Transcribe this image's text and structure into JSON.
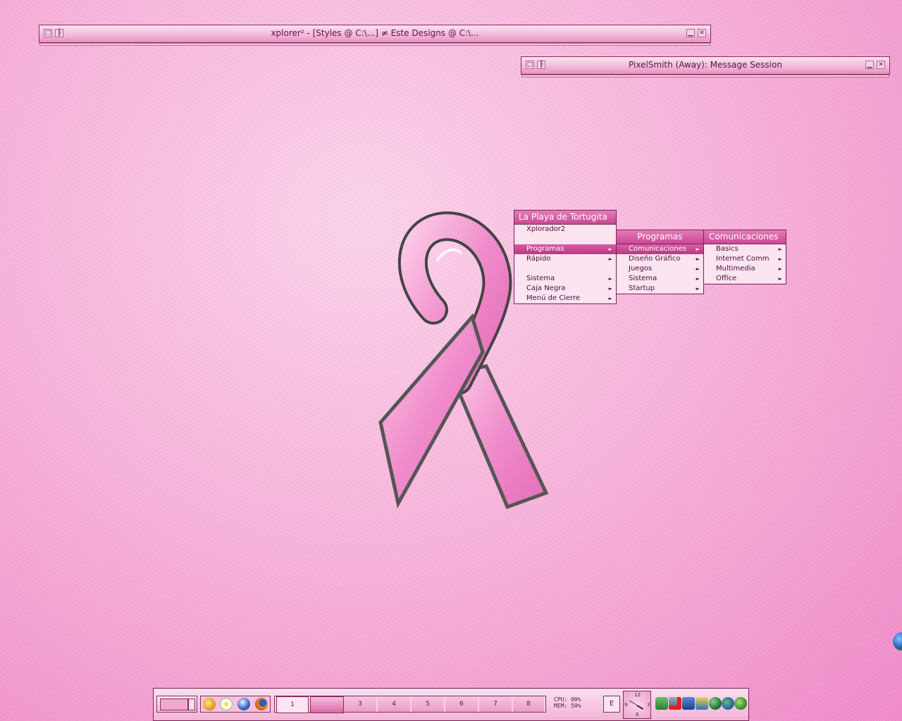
{
  "windows": {
    "xplorer": {
      "title": "xplorer² - [Styles @ C:\\...] ≠ Este Designs @ C:\\..."
    },
    "message": {
      "title": "PixelSmith (Away): Message Session"
    }
  },
  "menus": {
    "main": {
      "title": "La Playa de Tortugita",
      "items": [
        "Xplorador2",
        "Programas",
        "Rápido",
        "Sistema",
        "Caja Negra",
        "Menú de Cierre"
      ]
    },
    "programas": {
      "title": "Programas",
      "items": [
        "Comunicaciones",
        "Diseño Gráfico",
        "Juegos",
        "Sistema",
        "Startup"
      ]
    },
    "comunicaciones": {
      "title": "Comunicaciones",
      "items": [
        "Basics",
        "Internet Comm",
        "Multimedia",
        "Office"
      ]
    }
  },
  "taskbar": {
    "workspaces": [
      "1",
      "",
      "3",
      "4",
      "5",
      "6",
      "7",
      "8"
    ],
    "cpu": "CPU: 00%",
    "mem": "MEM: 50%",
    "e_button": "E",
    "clock": {
      "n12": "12",
      "n3": "3",
      "n6": "6",
      "n9": "9"
    }
  },
  "colors": {
    "accent": "#c94a93",
    "border": "#7c1f57",
    "menu_bg": "#fce4f1"
  }
}
